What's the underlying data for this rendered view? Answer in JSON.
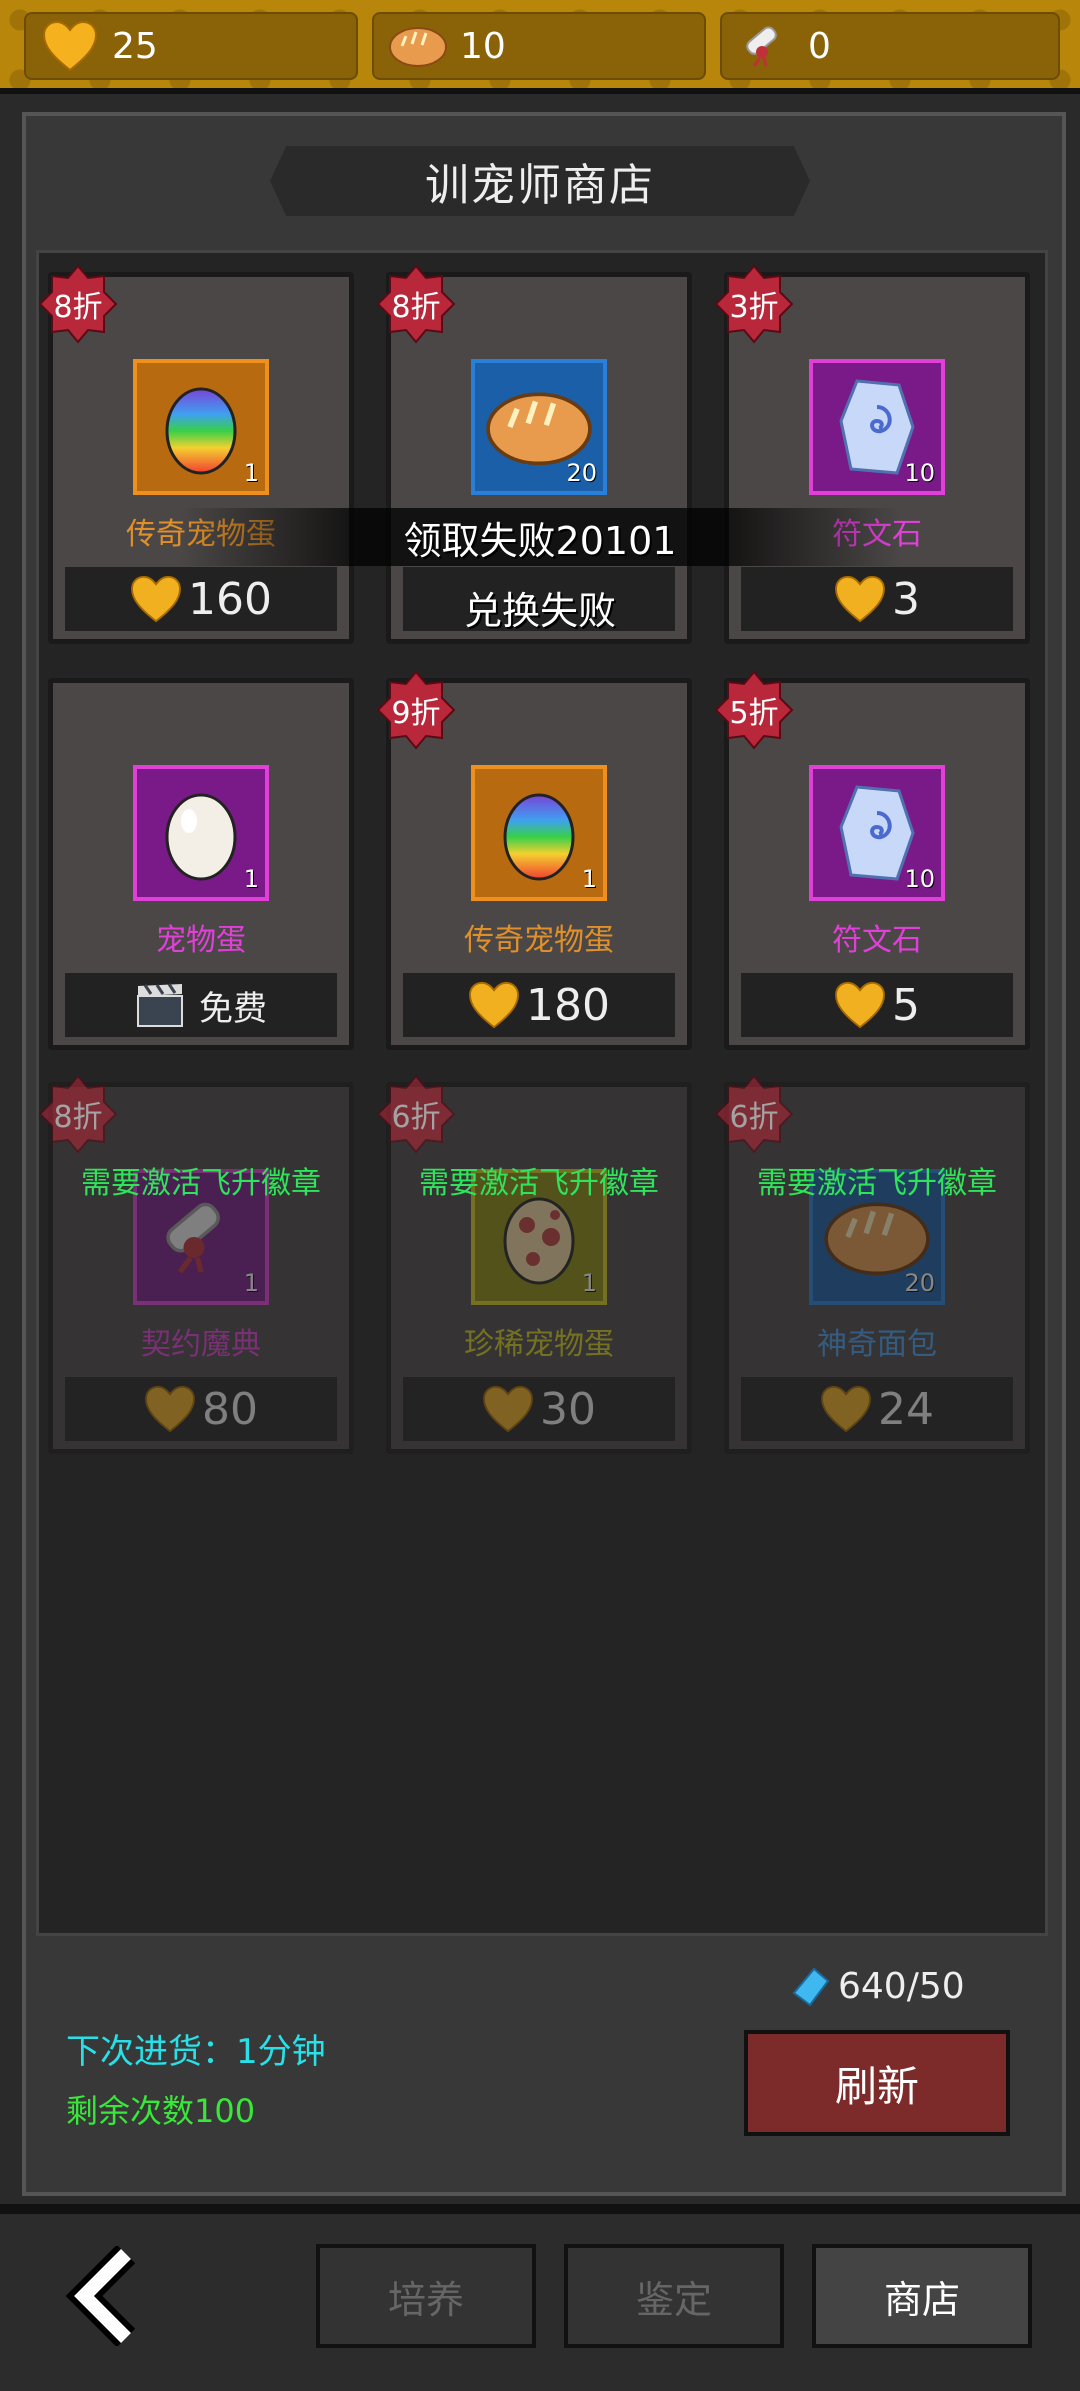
{
  "resources": [
    {
      "icon": "heart-icon",
      "value": "25"
    },
    {
      "icon": "bread-icon",
      "value": "10"
    },
    {
      "icon": "scroll-icon",
      "value": "0"
    }
  ],
  "shop": {
    "title": "训宠师商店"
  },
  "items": [
    {
      "discount": "8折",
      "name": "传奇宠物蛋",
      "count": "1",
      "price": "160",
      "icon": "rainbow-egg-icon",
      "frame": "orange"
    },
    {
      "discount": "8折",
      "name": "",
      "count": "20",
      "price": "",
      "icon": "bread-icon",
      "frame": "blue"
    },
    {
      "discount": "3折",
      "name": "符文石",
      "count": "10",
      "price": "3",
      "icon": "rune-stone-icon",
      "frame": "purple"
    },
    {
      "discount": "",
      "name": "宠物蛋",
      "count": "1",
      "price": "免费",
      "icon": "white-egg-icon",
      "frame": "purple"
    },
    {
      "discount": "9折",
      "name": "传奇宠物蛋",
      "count": "1",
      "price": "180",
      "icon": "rainbow-egg-icon",
      "frame": "orange"
    },
    {
      "discount": "5折",
      "name": "符文石",
      "count": "10",
      "price": "5",
      "icon": "rune-stone-icon",
      "frame": "purple"
    },
    {
      "discount": "8折",
      "name": "契约魔典",
      "count": "1",
      "price": "80",
      "icon": "scroll-icon",
      "frame": "purple",
      "locked": true
    },
    {
      "discount": "6折",
      "name": "珍稀宠物蛋",
      "count": "1",
      "price": "30",
      "icon": "spotted-egg-icon",
      "frame": "yellow",
      "locked": true
    },
    {
      "discount": "6折",
      "name": "神奇面包",
      "count": "20",
      "price": "24",
      "icon": "bread-icon",
      "frame": "blue",
      "locked": true
    }
  ],
  "locked_text": "需要激活飞升徽章",
  "toasts": {
    "claim_fail": "领取失败20101",
    "exchange_fail": "兑换失败"
  },
  "footer": {
    "next_restock": "下次进货：1分钟",
    "remaining": "剩余次数100",
    "gem": "640/50",
    "refresh": "刷新"
  },
  "tabs": [
    {
      "label": "培养"
    },
    {
      "label": "鉴定"
    },
    {
      "label": "商店"
    }
  ],
  "colors": {
    "gold": "#f0b020",
    "name_orange": "#e0902a",
    "name_magenta": "#e040d8",
    "locked_green": "#2fe35a",
    "refresh_red": "#7c2a2a"
  }
}
